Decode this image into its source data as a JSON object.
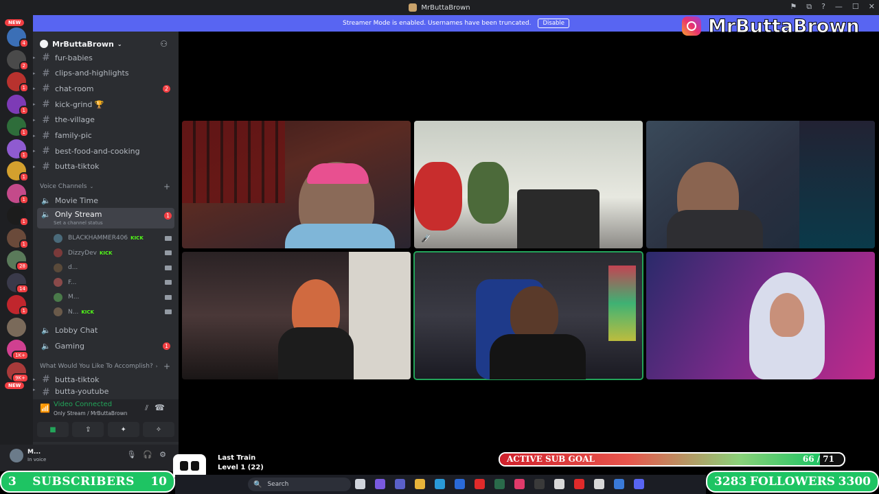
{
  "window": {
    "title": "MrButtaBrown",
    "controls": [
      "⚑",
      "⧉",
      "?",
      "—",
      "☐",
      "✕"
    ]
  },
  "guilds": {
    "new_top": "NEW",
    "new_bottom": "NEW",
    "items": [
      {
        "badge": "4",
        "color": "#3b6fb6"
      },
      {
        "badge": "2",
        "color": "#4a4a4a"
      },
      {
        "badge": "1",
        "color": "#b8322e"
      },
      {
        "badge": "1",
        "color": "#7d3bb6"
      },
      {
        "badge": "1",
        "color": "#2e6d3a"
      },
      {
        "badge": "1",
        "color": "#8f5bd0"
      },
      {
        "badge": "1",
        "color": "#d3a02e"
      },
      {
        "badge": "1",
        "color": "#c44a8a"
      },
      {
        "badge": "1",
        "color": "#1c1c1c"
      },
      {
        "badge": "1",
        "color": "#6a4a3a"
      },
      {
        "badge": "28",
        "color": "#5a7a5a"
      },
      {
        "badge": "14",
        "color": "#3a3a4a"
      },
      {
        "badge": "1",
        "color": "#c0262d"
      },
      {
        "badge": "",
        "color": "#7a6a5a"
      },
      {
        "badge": "1K+",
        "color": "#d04090"
      },
      {
        "badge": "9K+",
        "color": "#a83a3a"
      }
    ]
  },
  "server": {
    "name": "MrButtaBrown",
    "text_channels": [
      {
        "name": "fur-babies",
        "count": ""
      },
      {
        "name": "clips-and-highlights",
        "count": ""
      },
      {
        "name": "chat-room",
        "count": "2"
      },
      {
        "name": "kick-grind 🏆",
        "count": ""
      },
      {
        "name": "the-village",
        "count": ""
      },
      {
        "name": "family-pic",
        "count": ""
      },
      {
        "name": "best-food-and-cooking",
        "count": ""
      },
      {
        "name": "butta-tiktok",
        "count": ""
      }
    ],
    "voice_category": "Voice Channels",
    "voice_channels": {
      "movie_time": "Movie Time",
      "only_stream": "Only Stream",
      "only_stream_count": "1",
      "only_stream_status": "Set a channel status",
      "lobby_chat": "Lobby Chat",
      "gaming": "Gaming",
      "gaming_count": "1"
    },
    "voice_users": [
      {
        "name": "BLACKHAMMER406",
        "kick": "KICK",
        "color": "#4a6a7a"
      },
      {
        "name": "DizzyDev",
        "kick": "KICK",
        "color": "#7a3a3a"
      },
      {
        "name": "d...",
        "kick": "",
        "color": "#5a4a3a"
      },
      {
        "name": "F...",
        "kick": "",
        "color": "#8a4a4a"
      },
      {
        "name": "M...",
        "kick": "",
        "color": "#4a7a4a"
      },
      {
        "name": "N...",
        "kick": "KICK",
        "color": "#6a5a4a"
      }
    ],
    "category2": "What Would You Like To Accomplish?",
    "bottom_channels": [
      {
        "name": "butta-tiktok"
      },
      {
        "name": "butta-youtube"
      }
    ]
  },
  "voice_panel": {
    "status": "Video Connected",
    "where": "Only Stream / MrButtaBrown",
    "buttons": [
      "■",
      "⇪",
      "✦",
      "✧"
    ]
  },
  "user_panel": {
    "name": "M...",
    "status": "In voice"
  },
  "banner": {
    "text": "Streamer Mode is enabled. Usernames have been truncated.",
    "button": "Disable"
  },
  "overlay": {
    "instagram": "MrButtaBrown",
    "game_title": "Last Train",
    "level": "Level 1  (22)",
    "sub_goal_label": "ACTIVE SUB GOAL",
    "sub_goal_current": 66,
    "sub_goal_target": 71,
    "sub_goal_text": "66 / 71",
    "subscribers_left": "3",
    "subscribers_label": "SUBSCRIBERS",
    "subscribers_right": "10",
    "followers_left": "3283",
    "followers_label": "FOLLOWERS",
    "followers_right": "3300"
  },
  "taskbar": {
    "search_placeholder": "Search"
  }
}
